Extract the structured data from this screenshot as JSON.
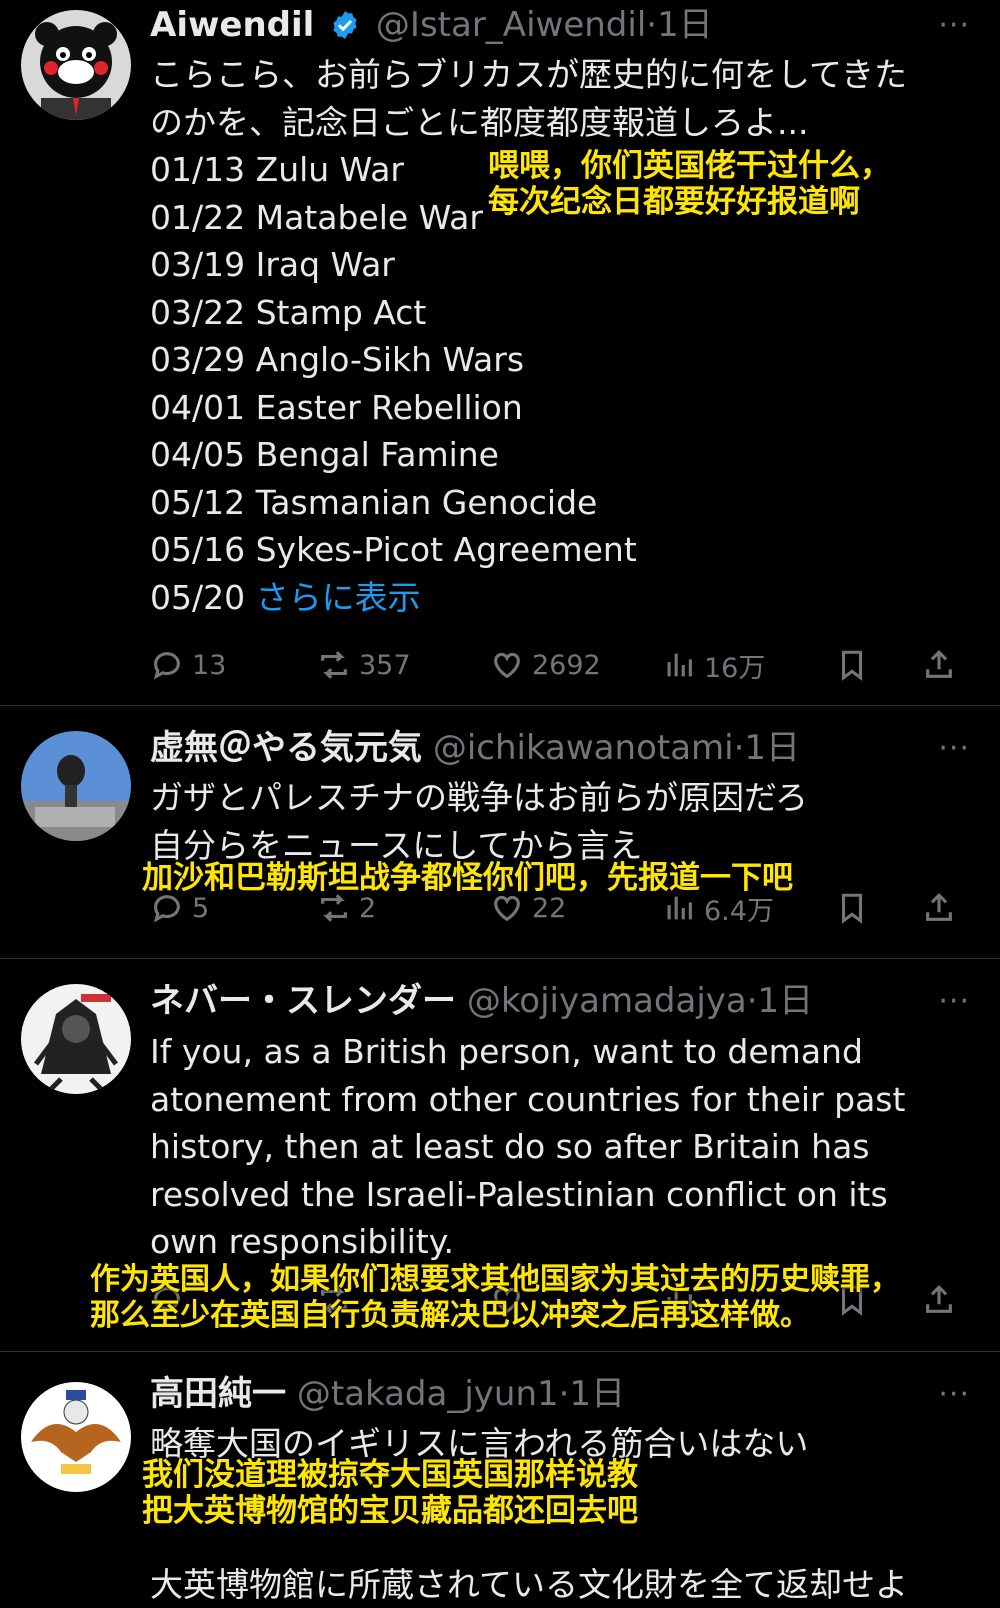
{
  "posts": [
    {
      "name": "Aiwendil",
      "handle": "@Istar_Aiwendil",
      "time": "·1日",
      "body_lines": [
        "こらこら、お前らブリカスが歴史的に何をしてきた",
        "のかを、記念日ごとに都度都度報道しろよ...",
        "01/13 Zulu War",
        "01/22 Matabele War",
        "03/19 Iraq War",
        "03/22 Stamp Act",
        "03/29 Anglo-Sikh Wars",
        "04/01 Easter Rebellion",
        "04/05 Bengal Famine",
        "05/12 Tasmanian Genocide",
        "05/16 Sykes-Picot Agreement"
      ],
      "last_line_prefix": "05/20 ",
      "show_more": "さらに表示",
      "replies": "13",
      "reposts": "357",
      "likes": "2692",
      "views": "16万",
      "caption_lines": [
        "喂喂，你们英国佬干过什么，",
        "每次纪念日都要好好报道啊"
      ]
    },
    {
      "name": "虚無＠やる気元気",
      "handle": "@ichikawanotami",
      "time": "·1日",
      "body_lines": [
        "ガザとパレスチナの戦争はお前らが原因だろ",
        "自分らをニュースにしてから言え"
      ],
      "replies": "5",
      "reposts": "2",
      "likes": "22",
      "views": "6.4万",
      "caption_lines": [
        "加沙和巴勒斯坦战争都怪你们吧，先报道一下吧"
      ]
    },
    {
      "name": "ネバー・スレンダー",
      "handle": "@kojiyamadajya",
      "time": "·1日",
      "body_lines": [
        "If you, as a British person, want to demand",
        "atonement from other countries for their past",
        "history, then at least do so after Britain has",
        "resolved the Israeli-Palestinian conflict on its",
        "own responsibility."
      ],
      "caption_lines": [
        "作为英国人，如果你们想要求其他国家为其过去的历史赎罪，",
        "那么至少在英国自行负责解决巴以冲突之后再这样做。"
      ]
    },
    {
      "name": "高田純一",
      "handle": "@takada_jyun1",
      "time": "·1日",
      "body_lines": [
        "略奪大国のイギリスに言われる筋合いはない",
        "",
        "",
        "大英博物館に所蔵されている文化財を全て返却せよ"
      ],
      "caption_lines": [
        "我们没道理被掠夺大国英国那样说教",
        "把大英博物馆的宝贝藏品都还回去吧"
      ]
    }
  ],
  "more_label": "···",
  "colors": {
    "accent": "#1d9bf0",
    "caption": "#ffe600",
    "muted": "#71767b"
  },
  "icons": [
    "verified-badge-icon",
    "reply-icon",
    "repost-icon",
    "like-icon",
    "views-icon",
    "bookmark-icon",
    "share-icon",
    "more-icon"
  ]
}
